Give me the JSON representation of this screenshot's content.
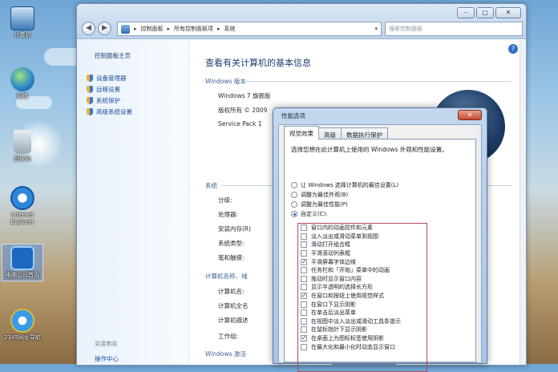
{
  "desktop": {
    "icons": [
      {
        "name": "computer",
        "label": "计算机",
        "icon": "computer-icon"
      },
      {
        "name": "network",
        "label": "网络",
        "icon": "network-icon"
      },
      {
        "name": "recycle-bin",
        "label": "回收站",
        "icon": "recycle-bin-icon"
      },
      {
        "name": "internet-explorer",
        "label": "Internet Explorer",
        "icon": "internet-explorer-icon"
      },
      {
        "name": "ie-shortcut",
        "label": "电脑公司首页",
        "icon": "ie-shortcut-icon"
      },
      {
        "name": "ie-shortcut-2",
        "label": "2345网址导航",
        "icon": "ie-blue-icon"
      }
    ]
  },
  "window": {
    "controls": [
      "–",
      "▢",
      "✕"
    ],
    "nav_back": "◀",
    "nav_forward": "▶",
    "breadcrumb": [
      "控制面板",
      "所有控制面板项",
      "系统"
    ],
    "search_placeholder": "搜索控制面板",
    "left_pane": {
      "home": "控制面板主页",
      "tasks": [
        "设备管理器",
        "远程设置",
        "系统保护",
        "高级系统设置"
      ],
      "see_also": "另请参阅",
      "action_center": "操作中心"
    },
    "main": {
      "title": "查看有关计算机的基本信息",
      "windows_edition_header": "Windows 版本",
      "edition": "Windows 7 旗舰版",
      "copyright": "版权所有 © 2009",
      "service_pack": "Service Pack 1",
      "system_header": "系统",
      "system_labels": [
        "分级:",
        "处理器:",
        "安装内存(R)",
        "系统类型:",
        "笔和触摸:"
      ],
      "computer_header": "计算机名称、域",
      "computer_labels": [
        "计算机名:",
        "计算机全名",
        "计算机描述",
        "工作组:"
      ],
      "activation_header": "Windows 激活"
    }
  },
  "dialog": {
    "title": "性能选项",
    "close": "✕",
    "tabs": [
      "视觉效果",
      "高级",
      "数据执行保护"
    ],
    "active_tab": 0,
    "description": "选择您想在此计算机上使用的 Windows 外观和性能设置。",
    "radios": [
      {
        "label": "让 Windows 选择计算机的最佳设置(L)",
        "checked": false
      },
      {
        "label": "调整为最佳外观(B)",
        "checked": false
      },
      {
        "label": "调整为最佳性能(P)",
        "checked": false
      },
      {
        "label": "自定义(C):",
        "checked": true
      }
    ],
    "options": [
      {
        "label": "窗口内的动画控件和元素",
        "checked": false
      },
      {
        "label": "淡入淡出或滑动菜单到视图",
        "checked": false
      },
      {
        "label": "滑动打开组合框",
        "checked": false
      },
      {
        "label": "平滑滚动列表框",
        "checked": false
      },
      {
        "label": "平滑屏幕字体边缘",
        "checked": true
      },
      {
        "label": "任务栏和「开始」菜单中的动画",
        "checked": false
      },
      {
        "label": "拖动时显示窗口内容",
        "checked": false
      },
      {
        "label": "显示半透明的选择长方形",
        "checked": false
      },
      {
        "label": "在窗口和按钮上使用视觉样式",
        "checked": true
      },
      {
        "label": "在窗口下显示阴影",
        "checked": false
      },
      {
        "label": "在单击后淡出菜单",
        "checked": false
      },
      {
        "label": "在视图中淡入淡出或滑动工具条提示",
        "checked": false
      },
      {
        "label": "在鼠标指针下显示阴影",
        "checked": false
      },
      {
        "label": "在桌面上为图标标签使用阴影",
        "checked": true
      },
      {
        "label": "在最大化和最小化时动态显示窗口",
        "checked": false
      }
    ]
  }
}
